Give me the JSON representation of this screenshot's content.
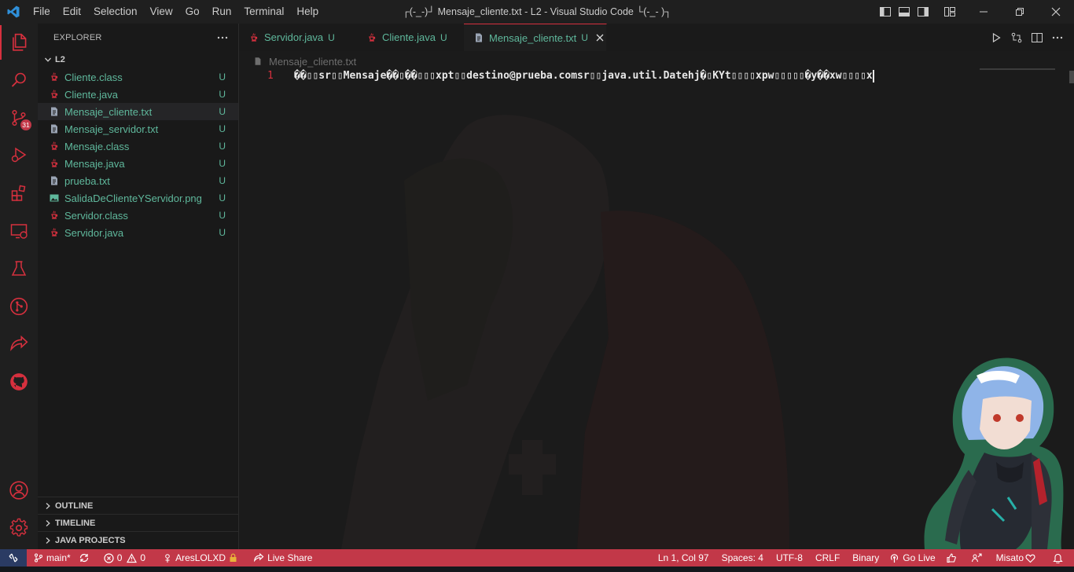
{
  "window": {
    "title": "┌(-_-)┘ Mensaje_cliente.txt - L2 - Visual Studio Code └(-_- )┐"
  },
  "menu": [
    "File",
    "Edit",
    "Selection",
    "View",
    "Go",
    "Run",
    "Terminal",
    "Help"
  ],
  "activity_bar": {
    "items": [
      "explorer-icon",
      "search-icon",
      "source-control-icon",
      "run-debug-icon",
      "extensions-icon",
      "remote-explorer-icon",
      "testing-icon",
      "git-graph-icon",
      "live-share-icon",
      "github-icon"
    ],
    "source_control_badge": "31",
    "bottom": [
      "account-icon",
      "manage-gear-icon"
    ]
  },
  "sidebar": {
    "title": "EXPLORER",
    "folder": "L2",
    "files": [
      {
        "name": "Cliente.class",
        "git": "U",
        "icon": "java-class-icon"
      },
      {
        "name": "Cliente.java",
        "git": "U",
        "icon": "java-icon"
      },
      {
        "name": "Mensaje_cliente.txt",
        "git": "U",
        "icon": "text-file-icon"
      },
      {
        "name": "Mensaje_servidor.txt",
        "git": "U",
        "icon": "text-file-icon"
      },
      {
        "name": "Mensaje.class",
        "git": "U",
        "icon": "java-class-icon"
      },
      {
        "name": "Mensaje.java",
        "git": "U",
        "icon": "java-icon"
      },
      {
        "name": "prueba.txt",
        "git": "U",
        "icon": "text-file-icon"
      },
      {
        "name": "SalidaDeClienteYServidor.png",
        "git": "U",
        "icon": "image-file-icon"
      },
      {
        "name": "Servidor.class",
        "git": "U",
        "icon": "java-class-icon"
      },
      {
        "name": "Servidor.java",
        "git": "U",
        "icon": "java-icon"
      }
    ],
    "sections": [
      "OUTLINE",
      "TIMELINE",
      "JAVA PROJECTS"
    ]
  },
  "tabs": [
    {
      "label": "Servidor.java",
      "git": "U"
    },
    {
      "label": "Cliente.java",
      "git": "U"
    },
    {
      "label": "Mensaje_cliente.txt",
      "git": "U"
    }
  ],
  "breadcrumb": "Mensaje_cliente.txt",
  "editor": {
    "line_number": "1",
    "line_text": "��▯▯sr▯▯Mensaje��▯��▯▯▯xpt▯▯destino@prueba.comsr▯▯java.util.Datehj�▯KYt▯▯▯▯xpw▯▯▯▯▯�y��xw▯▯▯▯x"
  },
  "status": {
    "branch": "main*",
    "errors": "0",
    "warnings": "0",
    "user": "AresLOLXD",
    "live_share": "Live Share",
    "position": "Ln 1, Col 97",
    "spaces": "Spaces: 4",
    "encoding": "UTF-8",
    "eol": "CRLF",
    "language": "Binary",
    "go_live": "Go Live",
    "theme_user": "Misato"
  },
  "colors": {
    "accent": "#d6303e",
    "statusbar": "#c23848",
    "untracked": "#5fb89c"
  }
}
